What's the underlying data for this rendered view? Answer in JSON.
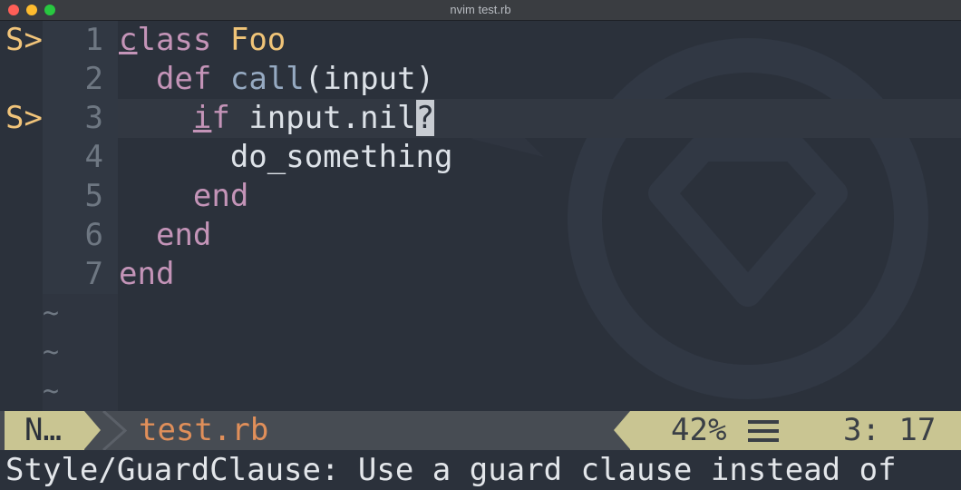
{
  "window": {
    "title": "nvim test.rb"
  },
  "editor": {
    "lines": [
      {
        "sign": "S>",
        "num": "1",
        "tokens": [
          {
            "t": "c",
            "c": "kw ul"
          },
          {
            "t": "lass",
            "c": "kw"
          },
          {
            "t": " ",
            "c": ""
          },
          {
            "t": "Foo",
            "c": "cls"
          }
        ]
      },
      {
        "sign": "",
        "num": "2",
        "tokens": [
          {
            "t": "  ",
            "c": ""
          },
          {
            "t": "def",
            "c": "kw"
          },
          {
            "t": " ",
            "c": ""
          },
          {
            "t": "call",
            "c": "fn"
          },
          {
            "t": "(input)",
            "c": ""
          }
        ]
      },
      {
        "sign": "S>",
        "num": "3",
        "tokens": [
          {
            "t": "    ",
            "c": ""
          },
          {
            "t": "i",
            "c": "kw ul"
          },
          {
            "t": "f",
            "c": "kw"
          },
          {
            "t": " input.nil",
            "c": ""
          },
          {
            "t": "?",
            "c": "blockcur"
          }
        ]
      },
      {
        "sign": "",
        "num": "4",
        "tokens": [
          {
            "t": "      do_something",
            "c": ""
          }
        ]
      },
      {
        "sign": "",
        "num": "5",
        "tokens": [
          {
            "t": "    ",
            "c": ""
          },
          {
            "t": "end",
            "c": "kw"
          }
        ]
      },
      {
        "sign": "",
        "num": "6",
        "tokens": [
          {
            "t": "  ",
            "c": ""
          },
          {
            "t": "end",
            "c": "kw"
          }
        ]
      },
      {
        "sign": "",
        "num": "7",
        "tokens": [
          {
            "t": "end",
            "c": "kw"
          }
        ]
      }
    ],
    "tildes": [
      "~",
      "~",
      "~"
    ]
  },
  "statusline": {
    "mode": "N…",
    "filename": "test.rb",
    "percent": "42%",
    "position": "3: 17",
    "menu_icon": "hamburger-icon"
  },
  "message": "Style/GuardClause: Use a guard clause instead of",
  "colors": {
    "background": "#2b313b",
    "accent": "#c9c592",
    "filename": "#e08f5a",
    "keyword": "#c494b8",
    "class": "#f0c478",
    "sign": "#f1c47a"
  }
}
